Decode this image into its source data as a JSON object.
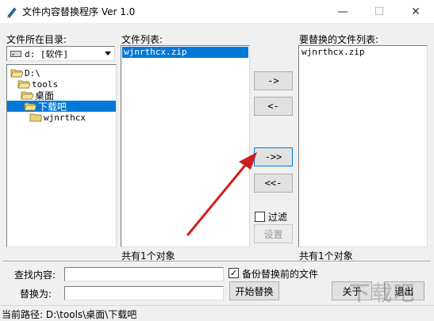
{
  "window": {
    "title": "文件内容替换程序 Ver 1.0",
    "minimize_glyph": "—",
    "maximize_glyph": "☐",
    "close_glyph": "✕",
    "icon": "pen-icon"
  },
  "directory": {
    "label": "文件所在目录:",
    "drive_value": "d: [软件]",
    "tree": [
      {
        "label": "D:\\",
        "open": true
      },
      {
        "label": "tools",
        "open": true
      },
      {
        "label": "桌面",
        "open": true
      },
      {
        "label": "下载吧",
        "open": true,
        "selected": true
      },
      {
        "label": "wjnrthcx",
        "open": false
      }
    ]
  },
  "file_list": {
    "label": "文件列表:",
    "items": [
      "wjnrthcx.zip"
    ],
    "count_text": "共有1个对象"
  },
  "transfer_buttons": {
    "add": "->",
    "remove": "<-",
    "add_all": "->>",
    "remove_all": "<<-"
  },
  "filter": {
    "label": "过滤",
    "checked": false,
    "settings_label": "设置"
  },
  "replace_list": {
    "label": "要替换的文件列表:",
    "items": [
      "wjnrthcx.zip"
    ],
    "count_text": "共有1个对象"
  },
  "form": {
    "find_label": "查找内容:",
    "find_value": "",
    "replace_label": "替换为:",
    "replace_value": "",
    "backup_label": "备份替换前的文件",
    "backup_checked": true,
    "backup_mark": "✓",
    "start_label": "开始替换",
    "about_label": "关于",
    "exit_label": "退出"
  },
  "status": {
    "current_path": "当前路径: D:\\tools\\桌面\\下载吧"
  },
  "watermark": "下载吧",
  "colors": {
    "selection": "#0078d7",
    "arrow": "#cc1f1f"
  }
}
